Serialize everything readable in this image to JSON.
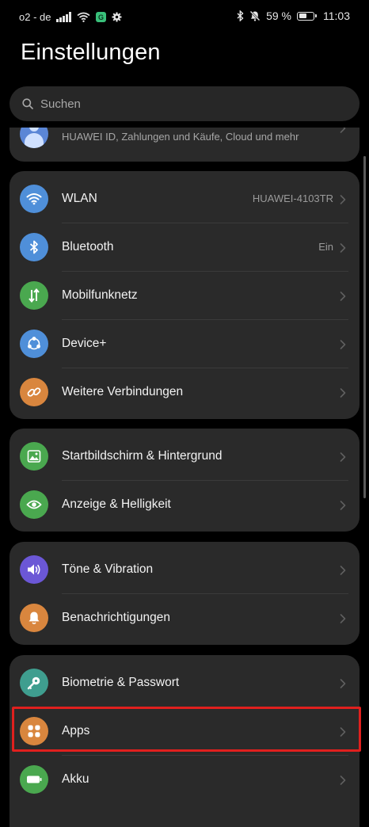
{
  "status_bar": {
    "carrier": "o2 - de",
    "app_badge": "G",
    "battery_percent": "59 %",
    "battery_level": 0.59,
    "time": "11:03",
    "icons": [
      "signal-icon",
      "wifi-icon",
      "app-badge-icon",
      "settings-gear-icon",
      "bluetooth-icon",
      "mute-bell-icon",
      "battery-icon"
    ]
  },
  "page": {
    "title": "Einstellungen"
  },
  "search": {
    "placeholder": "Suchen"
  },
  "account": {
    "subtitle": "HUAWEI ID, Zahlungen und Käufe, Cloud und mehr"
  },
  "groups": [
    {
      "items": [
        {
          "label": "WLAN",
          "value": "HUAWEI-4103TR",
          "icon": "wifi-icon",
          "color": "#4f8fd9"
        },
        {
          "label": "Bluetooth",
          "value": "Ein",
          "icon": "bluetooth-icon",
          "color": "#4f8fd9"
        },
        {
          "label": "Mobilfunknetz",
          "value": "",
          "icon": "mobile-data-icon",
          "color": "#4aa84f"
        },
        {
          "label": "Device+",
          "value": "",
          "icon": "device-plus-icon",
          "color": "#4f8fd9"
        },
        {
          "label": "Weitere Verbindungen",
          "value": "",
          "icon": "link-icon",
          "color": "#d9863e"
        }
      ]
    },
    {
      "items": [
        {
          "label": "Startbildschirm & Hintergrund",
          "value": "",
          "icon": "wallpaper-icon",
          "color": "#4aa84f"
        },
        {
          "label": "Anzeige & Helligkeit",
          "value": "",
          "icon": "eye-icon",
          "color": "#4aa84f"
        }
      ]
    },
    {
      "items": [
        {
          "label": "Töne & Vibration",
          "value": "",
          "icon": "speaker-icon",
          "color": "#6b57d6"
        },
        {
          "label": "Benachrichtigungen",
          "value": "",
          "icon": "bell-icon",
          "color": "#d9863e"
        }
      ]
    },
    {
      "items": [
        {
          "label": "Biometrie & Passwort",
          "value": "",
          "icon": "key-icon",
          "color": "#3f9e8f"
        },
        {
          "label": "Apps",
          "value": "",
          "icon": "apps-grid-icon",
          "color": "#d9863e"
        },
        {
          "label": "Akku",
          "value": "",
          "icon": "battery-icon",
          "color": "#4aa84f"
        }
      ]
    }
  ],
  "highlight_color": "#e0201e"
}
